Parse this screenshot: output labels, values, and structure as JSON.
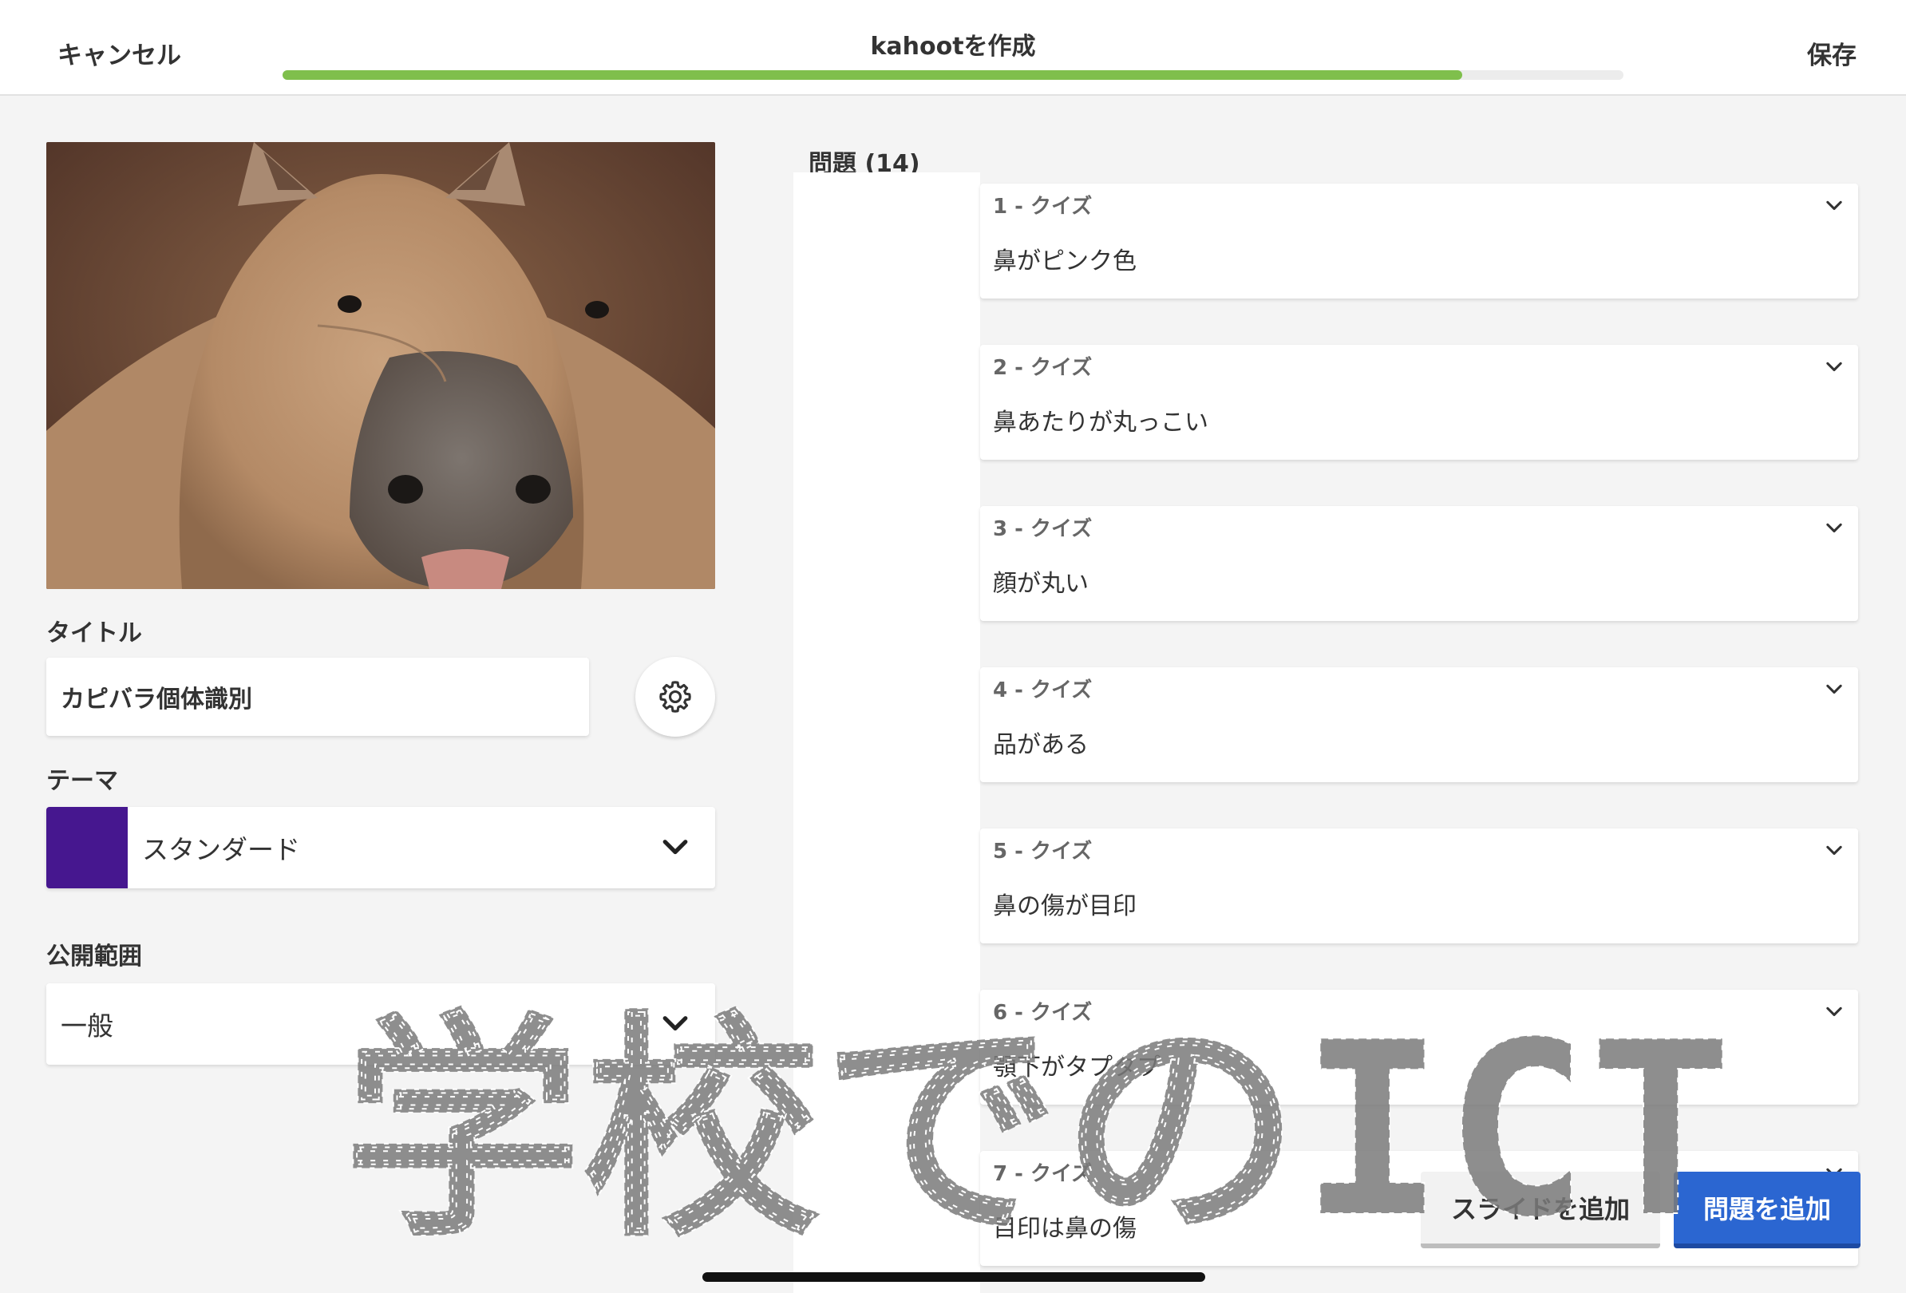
{
  "header": {
    "cancel_label": "キャンセル",
    "title": "kahootを作成",
    "save_label": "保存",
    "progress_fraction": 0.88
  },
  "cover": {
    "edit_icon": "pencil-icon",
    "remove_icon": "close-icon"
  },
  "title_section": {
    "label": "タイトル",
    "value": "カピバラ個体識別",
    "settings_icon": "gear-icon"
  },
  "theme_section": {
    "label": "テーマ",
    "value": "スタンダード",
    "swatch_color": "#46178f"
  },
  "visibility_section": {
    "label": "公開範囲",
    "value": "一般"
  },
  "questions": {
    "header": "問題 (14)",
    "items": [
      {
        "head": "1 - クイズ",
        "text": "鼻がピンク色"
      },
      {
        "head": "2 - クイズ",
        "text": "鼻あたりが丸っこい"
      },
      {
        "head": "3 - クイズ",
        "text": "顔が丸い"
      },
      {
        "head": "4 - クイズ",
        "text": "品がある"
      },
      {
        "head": "5 - クイズ",
        "text": "鼻の傷が目印"
      },
      {
        "head": "6 - クイズ",
        "text": "顎下がタプタプ"
      },
      {
        "head": "7 - クイズ",
        "text": "目印は鼻の傷"
      }
    ]
  },
  "actions": {
    "add_slide_label": "スライドを追加",
    "add_question_label": "問題を追加"
  },
  "watermark": {
    "text": "学校でのICT"
  },
  "colors": {
    "progress": "#7fbf4c",
    "primary_button": "#2b66d1"
  }
}
